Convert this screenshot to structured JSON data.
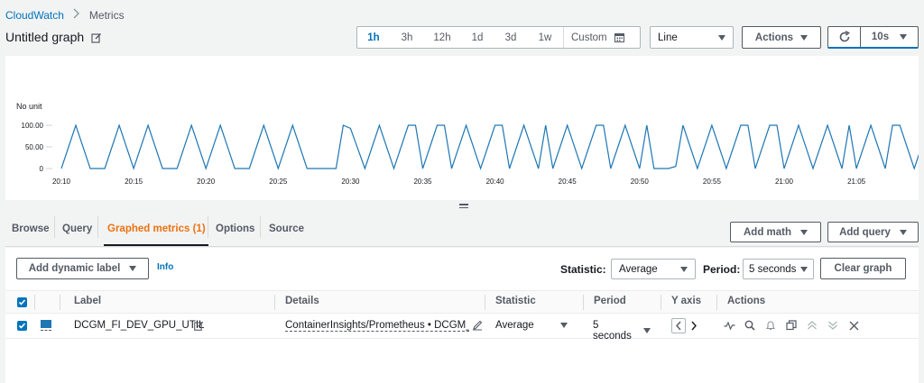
{
  "breadcrumb": {
    "service": "CloudWatch",
    "current": "Metrics"
  },
  "graph": {
    "title": "Untitled graph"
  },
  "time_range": {
    "options": [
      "1h",
      "3h",
      "12h",
      "1d",
      "3d",
      "1w"
    ],
    "active": "1h",
    "custom_label": "Custom"
  },
  "chart_type_select": {
    "value": "Line"
  },
  "actions_button": {
    "label": "Actions"
  },
  "refresh_interval": {
    "value": "10s"
  },
  "chart_data": {
    "type": "line",
    "ylabel": "No unit",
    "yticks": [
      "100.00",
      "50.00",
      "0"
    ],
    "ylim": [
      0,
      100
    ],
    "xticks": [
      "20:10",
      "20:15",
      "20:20",
      "20:25",
      "20:30",
      "20:35",
      "20:40",
      "20:45",
      "20:50",
      "20:55",
      "21:00",
      "21:05"
    ],
    "x_minutes_from_2010": [
      0,
      1,
      2,
      3,
      4,
      5,
      6,
      7,
      8,
      9,
      10,
      11,
      12,
      13,
      14,
      15,
      16,
      17,
      18,
      19,
      19.5,
      20,
      21,
      22,
      23,
      24,
      24.5,
      25,
      26,
      26.5,
      27,
      28,
      29,
      30,
      30.5,
      31,
      32,
      33,
      33.5,
      34,
      35,
      36,
      37,
      37.5,
      38,
      39,
      40,
      40.5,
      41,
      42,
      42.5,
      43,
      44,
      45,
      46,
      47,
      47.5,
      48,
      49,
      49.5,
      50,
      51,
      52,
      53,
      54,
      54.5,
      55,
      56,
      57,
      57.5,
      58,
      59,
      60,
      61,
      61.5,
      62,
      63,
      64,
      64.5,
      65,
      66,
      66.5,
      67,
      68
    ],
    "values": [
      0,
      100,
      0,
      0,
      100,
      0,
      100,
      0,
      0,
      100,
      0,
      100,
      0,
      0,
      100,
      0,
      100,
      0,
      0,
      0,
      100,
      93,
      0,
      100,
      0,
      100,
      100,
      0,
      100,
      100,
      0,
      100,
      0,
      100,
      100,
      0,
      100,
      0,
      100,
      0,
      100,
      0,
      100,
      100,
      0,
      100,
      0,
      100,
      0,
      0,
      5,
      100,
      0,
      100,
      0,
      100,
      100,
      0,
      100,
      100,
      0,
      100,
      0,
      100,
      0,
      100,
      0,
      100,
      0,
      100,
      100,
      0,
      100,
      0,
      100,
      100,
      0,
      100,
      0,
      100,
      100,
      0,
      100,
      0
    ]
  },
  "tabs": [
    {
      "label": "Browse"
    },
    {
      "label": "Query"
    },
    {
      "label": "Graphed metrics (1)"
    },
    {
      "label": "Options"
    },
    {
      "label": "Source"
    }
  ],
  "buttons": {
    "add_math": "Add math",
    "add_query": "Add query",
    "add_dynamic_label": "Add dynamic label",
    "info": "Info",
    "clear_graph": "Clear graph"
  },
  "controls": {
    "statistic_label": "Statistic:",
    "statistic_value": "Average",
    "period_label": "Period:",
    "period_value": "5 seconds"
  },
  "table": {
    "headers": {
      "label": "Label",
      "details": "Details",
      "statistic": "Statistic",
      "period": "Period",
      "y_axis": "Y axis",
      "actions": "Actions"
    },
    "rows": [
      {
        "series_color": "#1f77b4",
        "label": "DCGM_FI_DEV_GPU_UTIL",
        "details": "ContainerInsights/Prometheus • DCGM_FI_DEV_GPU_UTIL",
        "statistic": "Average",
        "period": "5 seconds"
      }
    ]
  },
  "colors": {
    "accent": "#0073bb",
    "active_tab": "#ec7211",
    "series": "#1f77b4"
  }
}
